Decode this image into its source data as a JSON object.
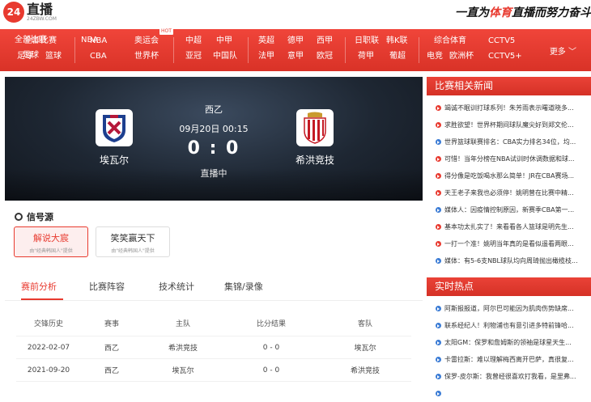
{
  "header": {
    "logo_mark": "24",
    "logo_text": "直播",
    "logo_sub": "24ZBW.COM",
    "slogan_pre": "一直为",
    "slogan_highlight": "体育",
    "slogan_post": "直播而努力奋斗"
  },
  "nav": {
    "groups": [
      [
        "全部比赛",
        "NBA",
        "足球",
        "CBA"
      ],
      [
        "篮球",
        "奥运会",
        "世界杯",
        ""
      ],
      [
        "中超",
        "中甲",
        "亚冠",
        "中国队"
      ],
      [
        "英超",
        "德甲",
        "法甲",
        "意甲"
      ],
      [
        "西甲",
        "日职联",
        "欧冠",
        "荷甲"
      ],
      [
        "韩K联",
        "综合体育",
        "葡超",
        "电竞"
      ],
      [
        "CCTV5",
        "欧洲杯",
        "CCTV5+",
        ""
      ]
    ],
    "links": [
      "全部比赛",
      "NBA",
      "奥运会",
      "中超",
      "中甲",
      "英超",
      "德甲",
      "西甲",
      "日职联",
      "韩K联",
      "综合体育",
      "CCTV5",
      "足球",
      "篮球",
      "CBA",
      "世界杯",
      "亚冠",
      "中国队",
      "法甲",
      "意甲",
      "欧冠",
      "荷甲",
      "葡超",
      "电竞",
      "欧洲杯",
      "CCTV5+"
    ],
    "hot_badge": "HOT",
    "more": "更多"
  },
  "match": {
    "league": "西乙",
    "time": "09月20日 00:15",
    "score": "0 : 0",
    "status": "直播中",
    "home": "埃瓦尔",
    "away": "希洪竞技"
  },
  "signal": {
    "title": "信号源",
    "sources": [
      {
        "name": "解说大宸",
        "sub": "由\"经典韩国人\"提供"
      },
      {
        "name": "笑笑赢天下",
        "sub": "由\"经典韩国人\"提供"
      }
    ]
  },
  "tabs": [
    "赛前分析",
    "比赛阵容",
    "技术统计",
    "集锦/录像"
  ],
  "history": {
    "headers": [
      "交锋历史",
      "赛事",
      "主队",
      "比分结果",
      "客队"
    ],
    "rows": [
      [
        "2022-02-07",
        "西乙",
        "希洪竞技",
        "0 - 0",
        "埃瓦尔"
      ],
      [
        "2021-09-20",
        "西乙",
        "埃瓦尔",
        "0 - 0",
        "希洪竞技"
      ]
    ]
  },
  "related_news": {
    "title": "比赛相关新闻",
    "items": [
      {
        "text": "竭诚不眠训打球系列！朱芳雨表示曙道晓多...",
        "color": "red"
      },
      {
        "text": "求胜欲望！世界杯期间球队魔尖好到郑文伦...",
        "color": "red"
      },
      {
        "text": "世界篮球联赛排名：CBA实力排名34位，均...",
        "color": "blue"
      },
      {
        "text": "可惜！当年分榜在NBA试训时休调数据和球...",
        "color": "red"
      },
      {
        "text": "得分像是吃饭喝水那么简单！JR在CBA赛场...",
        "color": "red"
      },
      {
        "text": "天王老子来我也必须停！姚明曾在比赛中精...",
        "color": "red"
      },
      {
        "text": "媒体人：因疫情控制原因，新赛季CBA第一...",
        "color": "blue"
      },
      {
        "text": "基本功太扎实了！来看看各人篮球是明先生...",
        "color": "red"
      },
      {
        "text": "一打一个准！姚明当年真的是看似遥看两眼...",
        "color": "red"
      },
      {
        "text": "媒体：有5-6支NBL球队均向周琦抛出橄榄枝...",
        "color": "blue"
      }
    ]
  },
  "hot_news": {
    "title": "实时热点",
    "items": [
      {
        "text": "阿斯报报道，阿尔巴可能因为肌肉伤势缺席...",
        "color": "blue"
      },
      {
        "text": "联系经纪人！利物浦也有意引进多特前锋哈...",
        "color": "blue"
      },
      {
        "text": "太阳GM：保罗和詹姆斯的领袖是球星天生...",
        "color": "blue"
      },
      {
        "text": "卡雷拉斯：难以理解梅西离开巴萨，真很复...",
        "color": "blue"
      },
      {
        "text": "保罗-皮尔斯：我曾经很喜欢打我看，是里弗...",
        "color": "blue"
      },
      {
        "text": "",
        "color": "blue"
      }
    ]
  }
}
